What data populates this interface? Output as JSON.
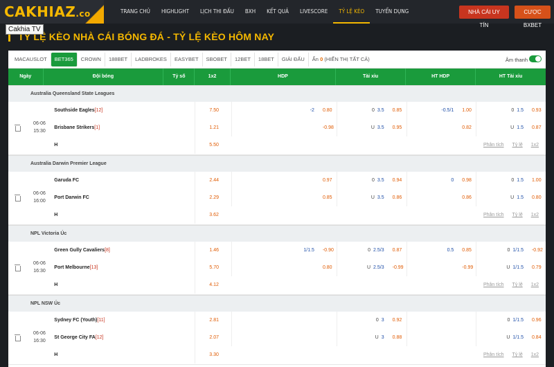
{
  "header": {
    "logo_main": "CAKHIAZ",
    "logo_suffix": ".co",
    "nav": [
      "TRANG CHỦ",
      "HIGHLIGHT",
      "LỊCH THI ĐẤU",
      "BXH",
      "KẾT QUẢ",
      "LIVESCORE",
      "TỶ LỆ KÈO",
      "TUYỂN DỤNG"
    ],
    "nav_active_index": 6,
    "btn_nha_cai": "NHÀ CÁI UY TÍN",
    "btn_cuoc": "CƯỢC BXBET",
    "tooltip": "Cakhia TV"
  },
  "page_title": "TỶ LỆ KÈO NHÀ CÁI BÓNG ĐÁ - TỶ LỆ KÈO HÔM NAY",
  "bookmakers": [
    "MACAUSLOT",
    "BET365",
    "CROWN",
    "188BET",
    "LADBROKES",
    "EASYBET",
    "SBOBET",
    "12BET",
    "18BET",
    "GIẢI ĐẤU"
  ],
  "bookmaker_active_index": 1,
  "hidden": {
    "label": "Ẩn",
    "count": "0",
    "show_all": "(HIỂN THỊ TẤT CẢ)"
  },
  "sound_label": "Âm thanh",
  "columns": {
    "time": "Ngày",
    "team": "Đội bóng",
    "score": "Tỷ số",
    "x12": "1x2",
    "hdp": "HDP",
    "tx": "Tài xỉu",
    "hthdp": "HT HDP",
    "httx": "HT Tài xỉu"
  },
  "row_links": [
    "Phân tích",
    "Tỷ lệ",
    "1x2"
  ],
  "colors": {
    "green": "#1a9b3c",
    "orange": "#f5b800",
    "red": "#c8351f"
  },
  "leagues": [
    {
      "name": "Australia Queensland State Leagues",
      "match": {
        "date": "06-06",
        "time": "15:30",
        "home": "Southside Eagles",
        "home_rank": "[12]",
        "away": "Brisbane Strikers",
        "away_rank": "[1]",
        "draw_label": "H",
        "x12": [
          "7.50",
          "1.21",
          "5.50"
        ],
        "hdp": [
          {
            "line": "-2",
            "val": "0.80"
          },
          {
            "line": "",
            "val": "-0.98"
          }
        ],
        "tx": [
          {
            "pre": "0",
            "line": "3.5",
            "val": "0.85"
          },
          {
            "pre": "U",
            "line": "3.5",
            "val": "0.95"
          }
        ],
        "hthdp": [
          {
            "line": "-0.5/1",
            "val": "1.00"
          },
          {
            "line": "",
            "val": "0.82"
          }
        ],
        "httx": [
          {
            "pre": "0",
            "line": "1.5",
            "val": "0.93"
          },
          {
            "pre": "U",
            "line": "1.5",
            "val": "0.87"
          }
        ]
      }
    },
    {
      "name": "Australia Darwin Premier League",
      "match": {
        "date": "06-06",
        "time": "16:00",
        "home": "Garuda FC",
        "home_rank": "",
        "away": "Port Darwin FC",
        "away_rank": "",
        "draw_label": "H",
        "x12": [
          "2.44",
          "2.29",
          "3.62"
        ],
        "hdp": [
          {
            "line": "",
            "val": "0.97"
          },
          {
            "line": "",
            "val": "0.85"
          }
        ],
        "tx": [
          {
            "pre": "0",
            "line": "3.5",
            "val": "0.94"
          },
          {
            "pre": "U",
            "line": "3.5",
            "val": "0.86"
          }
        ],
        "hthdp": [
          {
            "line": "0",
            "val": "0.98"
          },
          {
            "line": "",
            "val": "0.86"
          }
        ],
        "httx": [
          {
            "pre": "0",
            "line": "1.5",
            "val": "1.00"
          },
          {
            "pre": "U",
            "line": "1.5",
            "val": "0.80"
          }
        ]
      }
    },
    {
      "name": "NPL Victoria Úc",
      "match": {
        "date": "06-06",
        "time": "16:30",
        "home": "Green Gully Cavaliers",
        "home_rank": "[8]",
        "away": "Port Melbourne",
        "away_rank": "[13]",
        "draw_label": "H",
        "x12": [
          "1.46",
          "5.70",
          "4.12"
        ],
        "hdp": [
          {
            "line": "1/1.5",
            "val": "-0.90"
          },
          {
            "line": "",
            "val": "0.80"
          }
        ],
        "tx": [
          {
            "pre": "0",
            "line": "2.5/3",
            "val": "0.87"
          },
          {
            "pre": "U",
            "line": "2.5/3",
            "val": "-0.99"
          }
        ],
        "hthdp": [
          {
            "line": "0.5",
            "val": "0.85"
          },
          {
            "line": "",
            "val": "-0.99"
          }
        ],
        "httx": [
          {
            "pre": "0",
            "line": "1/1.5",
            "val": "-0.92"
          },
          {
            "pre": "U",
            "line": "1/1.5",
            "val": "0.79"
          }
        ]
      }
    },
    {
      "name": "NPL NSW Úc",
      "match": {
        "date": "06-06",
        "time": "16:30",
        "home": "Sydney FC (Youth)",
        "home_rank": "[11]",
        "away": "St George City FA",
        "away_rank": "[12]",
        "draw_label": "H",
        "x12": [
          "2.81",
          "2.07",
          "3.30"
        ],
        "hdp": [
          {
            "line": "",
            "val": ""
          },
          {
            "line": "",
            "val": ""
          }
        ],
        "tx": [
          {
            "pre": "0",
            "line": "3",
            "val": "0.92"
          },
          {
            "pre": "U",
            "line": "3",
            "val": "0.88"
          }
        ],
        "hthdp": [
          {
            "line": "",
            "val": ""
          },
          {
            "line": "",
            "val": ""
          }
        ],
        "httx": [
          {
            "pre": "0",
            "line": "1/1.5",
            "val": "0.96"
          },
          {
            "pre": "U",
            "line": "1/1.5",
            "val": "0.84"
          }
        ]
      }
    }
  ]
}
